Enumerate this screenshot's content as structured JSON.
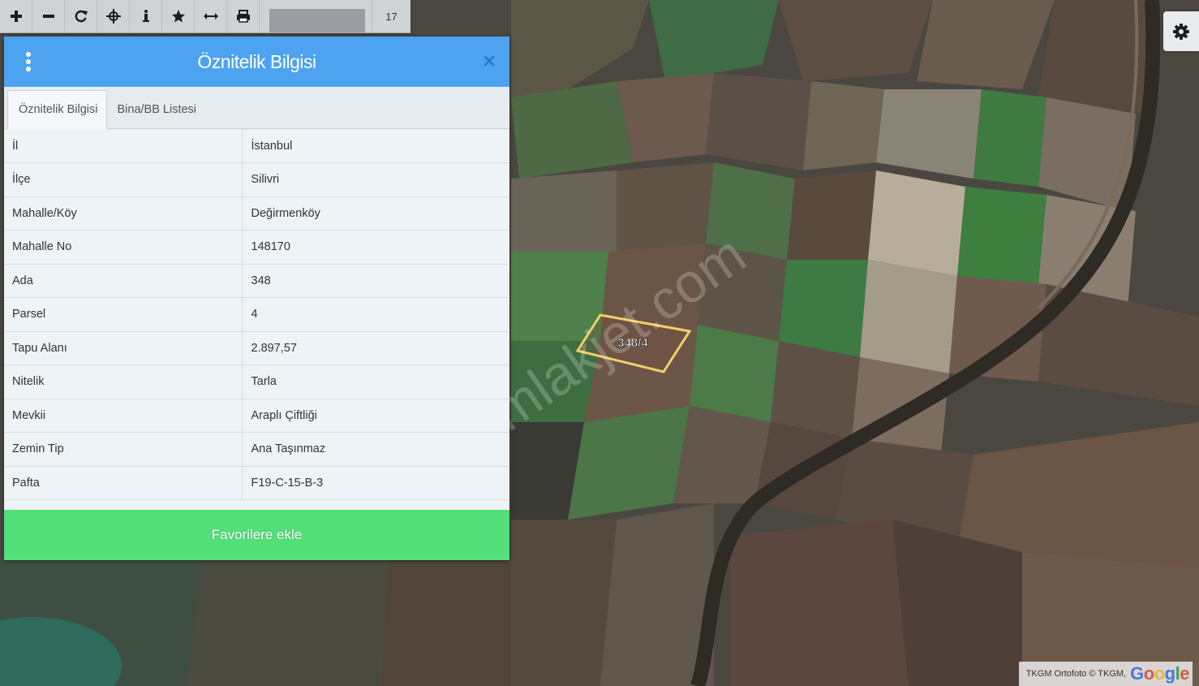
{
  "toolbar": {
    "buttons": [
      "zoom-in",
      "zoom-out",
      "refresh",
      "pan",
      "info",
      "favorite",
      "measure",
      "print"
    ],
    "zoom_level": "17"
  },
  "panel": {
    "title": "Öznitelik Bilgisi",
    "tabs": [
      {
        "label": "Öznitelik Bilgisi",
        "active": true
      },
      {
        "label": "Bina/BB Listesi",
        "active": false
      }
    ],
    "rows": [
      {
        "key": "İl",
        "value": "İstanbul"
      },
      {
        "key": "İlçe",
        "value": "Silivri"
      },
      {
        "key": "Mahalle/Köy",
        "value": "Değirmenköy"
      },
      {
        "key": "Mahalle No",
        "value": "148170"
      },
      {
        "key": "Ada",
        "value": "348"
      },
      {
        "key": "Parsel",
        "value": "4"
      },
      {
        "key": "Tapu Alanı",
        "value": "2.897,57"
      },
      {
        "key": "Nitelik",
        "value": "Tarla"
      },
      {
        "key": "Mevkii",
        "value": "Araplı Çiftliği"
      },
      {
        "key": "Zemin Tip",
        "value": "Ana Taşınmaz"
      },
      {
        "key": "Pafta",
        "value": "F19-C-15-B-3"
      }
    ],
    "favorite_button": "Favorilere ekle"
  },
  "map": {
    "parcel_label": "348/4",
    "watermark": "emlakjet.com",
    "attribution": "TKGM Ortofoto © TKGM,",
    "provider_logo": "Google"
  },
  "colors": {
    "header": "#4da3f0",
    "favorite": "#53e07a",
    "parcel_outline": "#f2d067"
  }
}
